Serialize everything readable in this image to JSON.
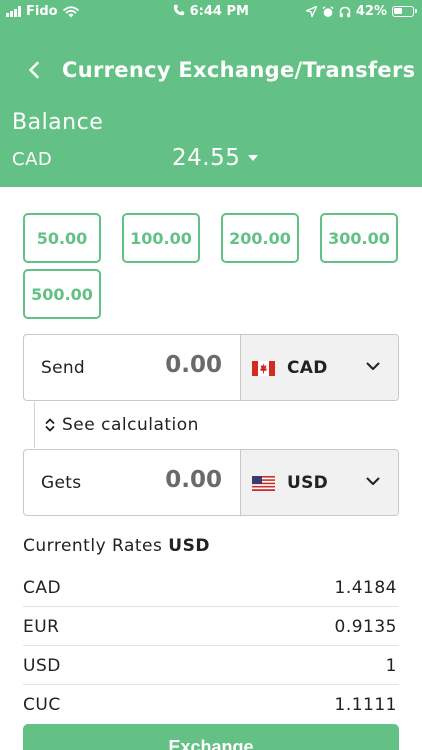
{
  "status_bar": {
    "carrier": "Fido",
    "time": "6:44 PM",
    "battery": "42%"
  },
  "nav": {
    "title": "Currency Exchange/Transfers"
  },
  "balance": {
    "label": "Balance",
    "currency": "CAD",
    "amount": "24.55"
  },
  "presets": [
    "50.00",
    "100.00",
    "200.00",
    "300.00",
    "500.00"
  ],
  "send": {
    "label": "Send",
    "value": "0.00",
    "currency": "CAD"
  },
  "calculation": {
    "label": "See calculation"
  },
  "gets": {
    "label": "Gets",
    "value": "0.00",
    "currency": "USD"
  },
  "rates": {
    "title_prefix": "Currently Rates",
    "title_currency": "USD",
    "items": [
      {
        "code": "CAD",
        "value": "1.4184"
      },
      {
        "code": "EUR",
        "value": "0.9135"
      },
      {
        "code": "USD",
        "value": "1"
      },
      {
        "code": "CUC",
        "value": "1.1111"
      }
    ]
  },
  "actions": {
    "exchange_label": "Exchange"
  },
  "colors": {
    "brand_green": "#64c185",
    "text_dark": "#222222",
    "input_gray": "#6a6a6a"
  }
}
